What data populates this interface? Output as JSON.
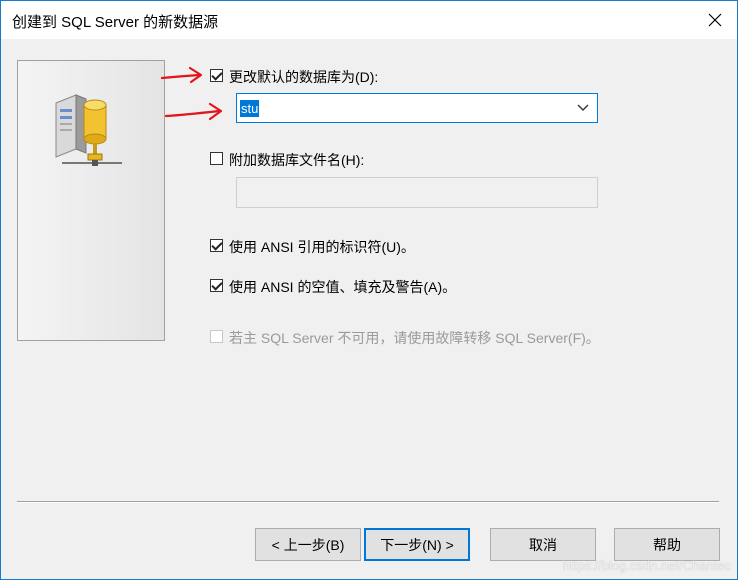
{
  "window": {
    "title": "创建到 SQL Server 的新数据源"
  },
  "options": {
    "change_default_db": {
      "label": "更改默认的数据库为(D):",
      "checked": true
    },
    "default_db_value": "stu",
    "attach_db_file": {
      "label": "附加数据库文件名(H):",
      "checked": false
    },
    "ansi_quoted": {
      "label": "使用 ANSI 引用的标识符(U)。",
      "checked": true
    },
    "ansi_nulls": {
      "label": "使用 ANSI 的空值、填充及警告(A)。",
      "checked": true
    },
    "failover": {
      "label": "若主 SQL Server 不可用，请使用故障转移 SQL Server(F)。",
      "checked": false,
      "disabled": true
    }
  },
  "buttons": {
    "back": "< 上一步(B)",
    "next": "下一步(N) >",
    "cancel": "取消",
    "help": "帮助"
  },
  "watermark": "https://blog.csdn.net/Chantec",
  "colors": {
    "accent": "#0078d7",
    "annotation": "#e0161b"
  },
  "icons": [
    "close-icon",
    "database-server-icon",
    "chevron-down-icon",
    "red-arrow-annotation"
  ]
}
